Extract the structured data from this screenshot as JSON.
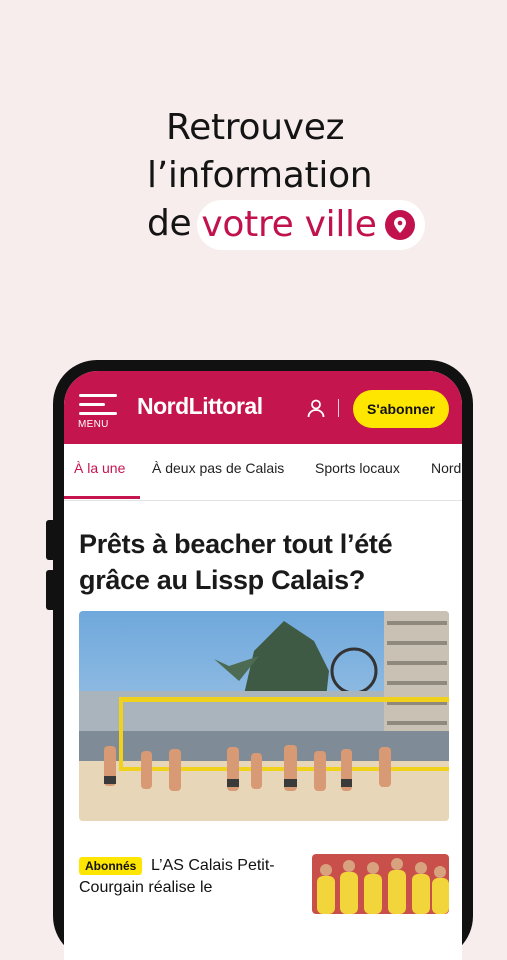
{
  "promo": {
    "line1": "Retrouvez",
    "line2": "l’information",
    "line3_prefix": "de",
    "line3_highlight": "votre ville",
    "pin_icon": "location-pin-icon",
    "accent_color": "#c1124e",
    "background_color": "#f8eded"
  },
  "app": {
    "menu_label": "MENU",
    "logo": "NordLittoral",
    "subscribe_label": "S'abonner",
    "brand_color": "#c5154f",
    "subscribe_color": "#ffe600",
    "tabs": [
      "À la une",
      "À deux pas de Calais",
      "Sports locaux",
      "Nord"
    ],
    "active_tab": "À la une",
    "article": {
      "title": "Prêts à beacher tout l’été grâce au Lissp Calais?"
    },
    "teaser": {
      "badge": "Abonnés",
      "text": "L’AS Calais Petit-Courgain réalise le"
    }
  }
}
